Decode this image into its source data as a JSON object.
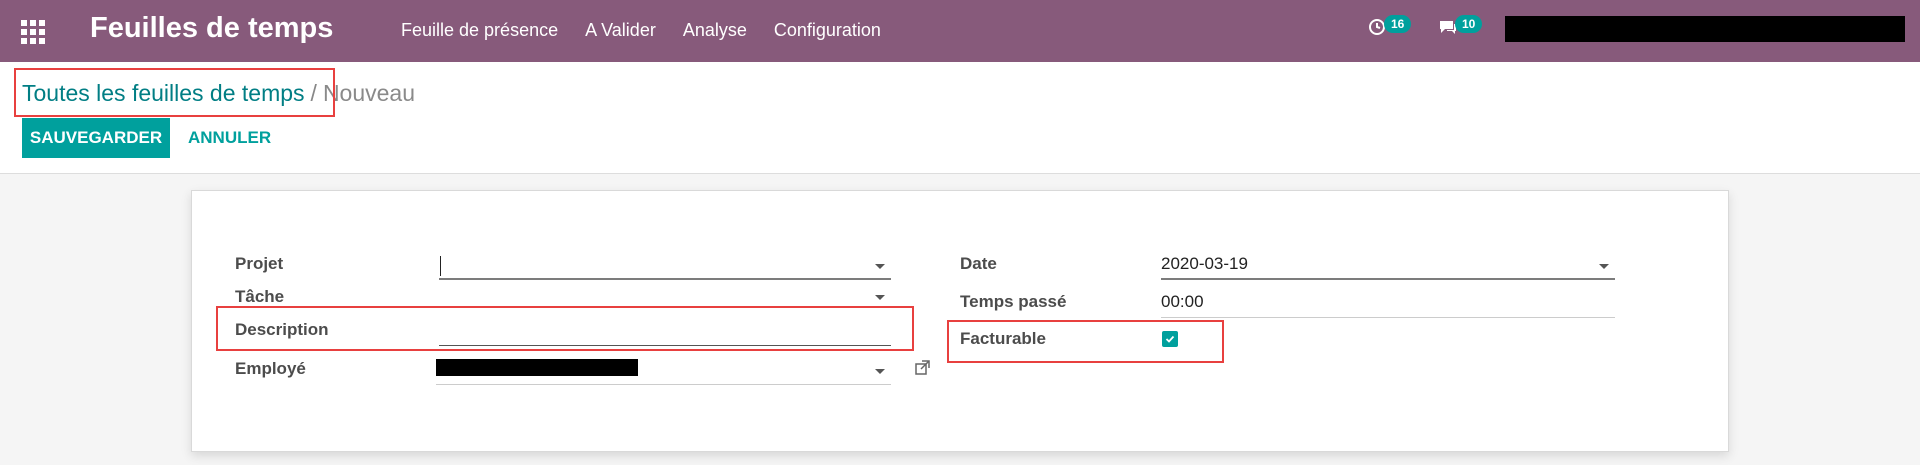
{
  "navbar": {
    "title": "Feuilles de temps",
    "menu": [
      "Feuille de présence",
      "A Valider",
      "Analyse",
      "Configuration"
    ],
    "activity_count": "16",
    "messages_count": "10",
    "background": "#875a7b"
  },
  "breadcrumb": {
    "parent": "Toutes les feuilles de temps",
    "separator": "/",
    "current": "Nouveau"
  },
  "actions": {
    "save_label": "SAUVEGARDER",
    "cancel_label": "ANNULER"
  },
  "form": {
    "left": {
      "projet_label": "Projet",
      "projet_value": "",
      "tache_label": "Tâche",
      "tache_value": "",
      "description_label": "Description",
      "description_value": "",
      "employe_label": "Employé"
    },
    "right": {
      "date_label": "Date",
      "date_value": "2020-03-19",
      "temps_label": "Temps passé",
      "temps_value": "00:00",
      "facturable_label": "Facturable",
      "facturable_checked": true
    }
  },
  "colors": {
    "accent": "#00a09d",
    "link": "#017e84",
    "highlight": "#e8403f"
  }
}
